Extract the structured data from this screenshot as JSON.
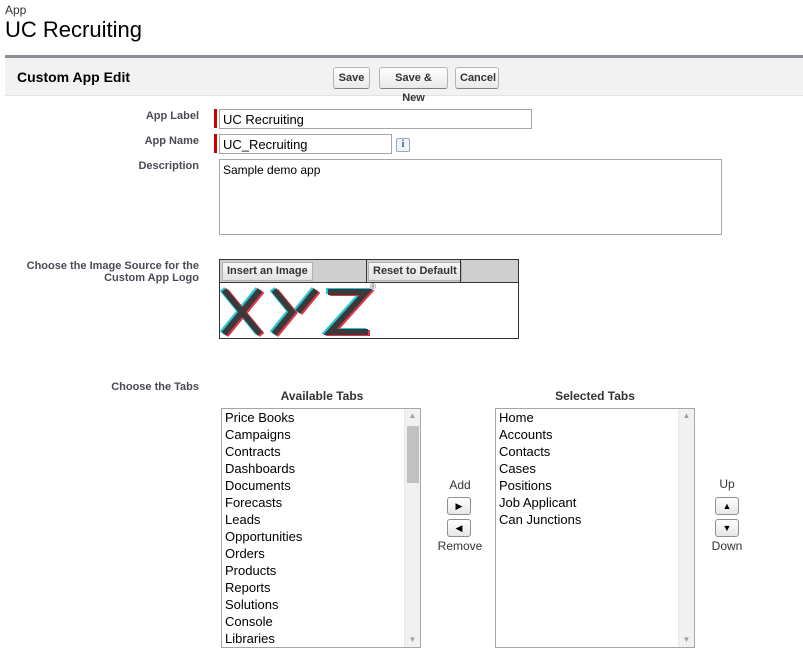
{
  "header": {
    "kicker": "App",
    "title": "UC Recruiting"
  },
  "panel": {
    "title": "Custom App Edit",
    "buttons": {
      "save": "Save",
      "save_new": "Save & New",
      "cancel": "Cancel"
    }
  },
  "form": {
    "app_label": {
      "label": "App Label",
      "value": "UC Recruiting"
    },
    "app_name": {
      "label": "App Name",
      "value": "UC_Recruiting",
      "info_icon": "i"
    },
    "description": {
      "label": "Description",
      "value": "Sample demo app"
    },
    "logo": {
      "label_line1": "Choose the Image Source for the",
      "label_line2": "Custom App Logo",
      "insert_button": "Insert an Image",
      "reset_button": "Reset to Default",
      "logo_text": "XYZ",
      "registered_mark": "®"
    },
    "tabs": {
      "label": "Choose the Tabs",
      "available_heading": "Available Tabs",
      "selected_heading": "Selected Tabs",
      "available": [
        "Price Books",
        "Campaigns",
        "Contracts",
        "Dashboards",
        "Documents",
        "Forecasts",
        "Leads",
        "Opportunities",
        "Orders",
        "Products",
        "Reports",
        "Solutions",
        "Console",
        "Libraries"
      ],
      "selected": [
        "Home",
        "Accounts",
        "Contacts",
        "Cases",
        "Positions",
        "Job Applicant",
        "Can Junctions"
      ],
      "add_label": "Add",
      "remove_label": "Remove",
      "up_label": "Up",
      "down_label": "Down"
    }
  },
  "icons": {
    "add_arrow": "▶",
    "remove_arrow": "◀",
    "up_arrow": "▲",
    "down_arrow": "▼",
    "scroll_up": "▲",
    "scroll_down": "▼"
  },
  "colors": {
    "required": "#cc0000",
    "logo_dark": "#3a3a3a",
    "logo_cyan": "#27c7d8",
    "logo_red": "#e0344b"
  }
}
